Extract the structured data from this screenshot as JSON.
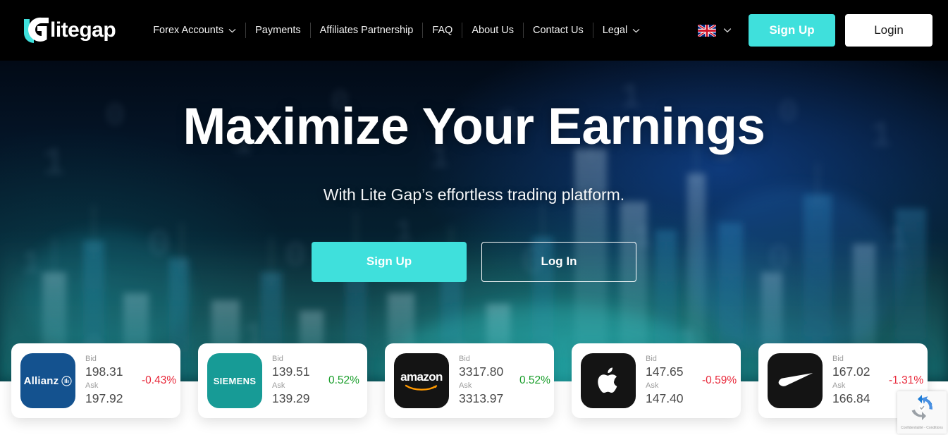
{
  "brand": {
    "logo_text": "litegap",
    "logo_icon": "litegap-logo-icon",
    "accent_color": "#3fe0dc"
  },
  "header": {
    "nav_items": [
      {
        "label": "Forex Accounts",
        "has_dropdown": true
      },
      {
        "label": "Payments",
        "has_dropdown": false
      },
      {
        "label": "Affiliates Partnership",
        "has_dropdown": false
      },
      {
        "label": "FAQ",
        "has_dropdown": false
      },
      {
        "label": "About Us",
        "has_dropdown": false
      },
      {
        "label": "Contact Us",
        "has_dropdown": false
      },
      {
        "label": "Legal",
        "has_dropdown": true
      }
    ],
    "language": {
      "selected": "English (UK)",
      "flag_icon": "uk-flag-icon",
      "chevron_icon": "chevron-down-icon"
    },
    "signup_label": "Sign Up",
    "login_label": "Login"
  },
  "hero": {
    "title": "Maximize Your Earnings",
    "subtitle": "With Lite Gap’s effortless trading platform.",
    "signup_label": "Sign Up",
    "login_label": "Log In"
  },
  "tickers": {
    "bid_label": "Bid",
    "ask_label": "Ask",
    "items": [
      {
        "name": "Allianz",
        "logo_icon": "allianz-logo-icon",
        "logo_text": "Allianz",
        "logo_bg": "#14528f",
        "bid": "198.31",
        "ask": "197.92",
        "change": "-0.43%",
        "direction": "down"
      },
      {
        "name": "Siemens",
        "logo_icon": "siemens-logo-icon",
        "logo_text": "SIEMENS",
        "logo_bg": "#179b96",
        "bid": "139.51",
        "ask": "139.29",
        "change": "0.52%",
        "direction": "up"
      },
      {
        "name": "Amazon",
        "logo_icon": "amazon-logo-icon",
        "logo_text": "amazon",
        "logo_bg": "#141414",
        "bid": "3317.80",
        "ask": "3313.97",
        "change": "0.52%",
        "direction": "up"
      },
      {
        "name": "Apple",
        "logo_icon": "apple-logo-icon",
        "logo_text": "",
        "logo_bg": "#141414",
        "bid": "147.65",
        "ask": "147.40",
        "change": "-0.59%",
        "direction": "down"
      },
      {
        "name": "Nike",
        "logo_icon": "nike-logo-icon",
        "logo_text": "",
        "logo_bg": "#141414",
        "bid": "167.02",
        "ask": "166.84",
        "change": "-1.31%",
        "direction": "down"
      }
    ]
  },
  "recaptcha": {
    "icon": "recaptcha-icon",
    "legal": "Confidentialité - Conditions"
  }
}
